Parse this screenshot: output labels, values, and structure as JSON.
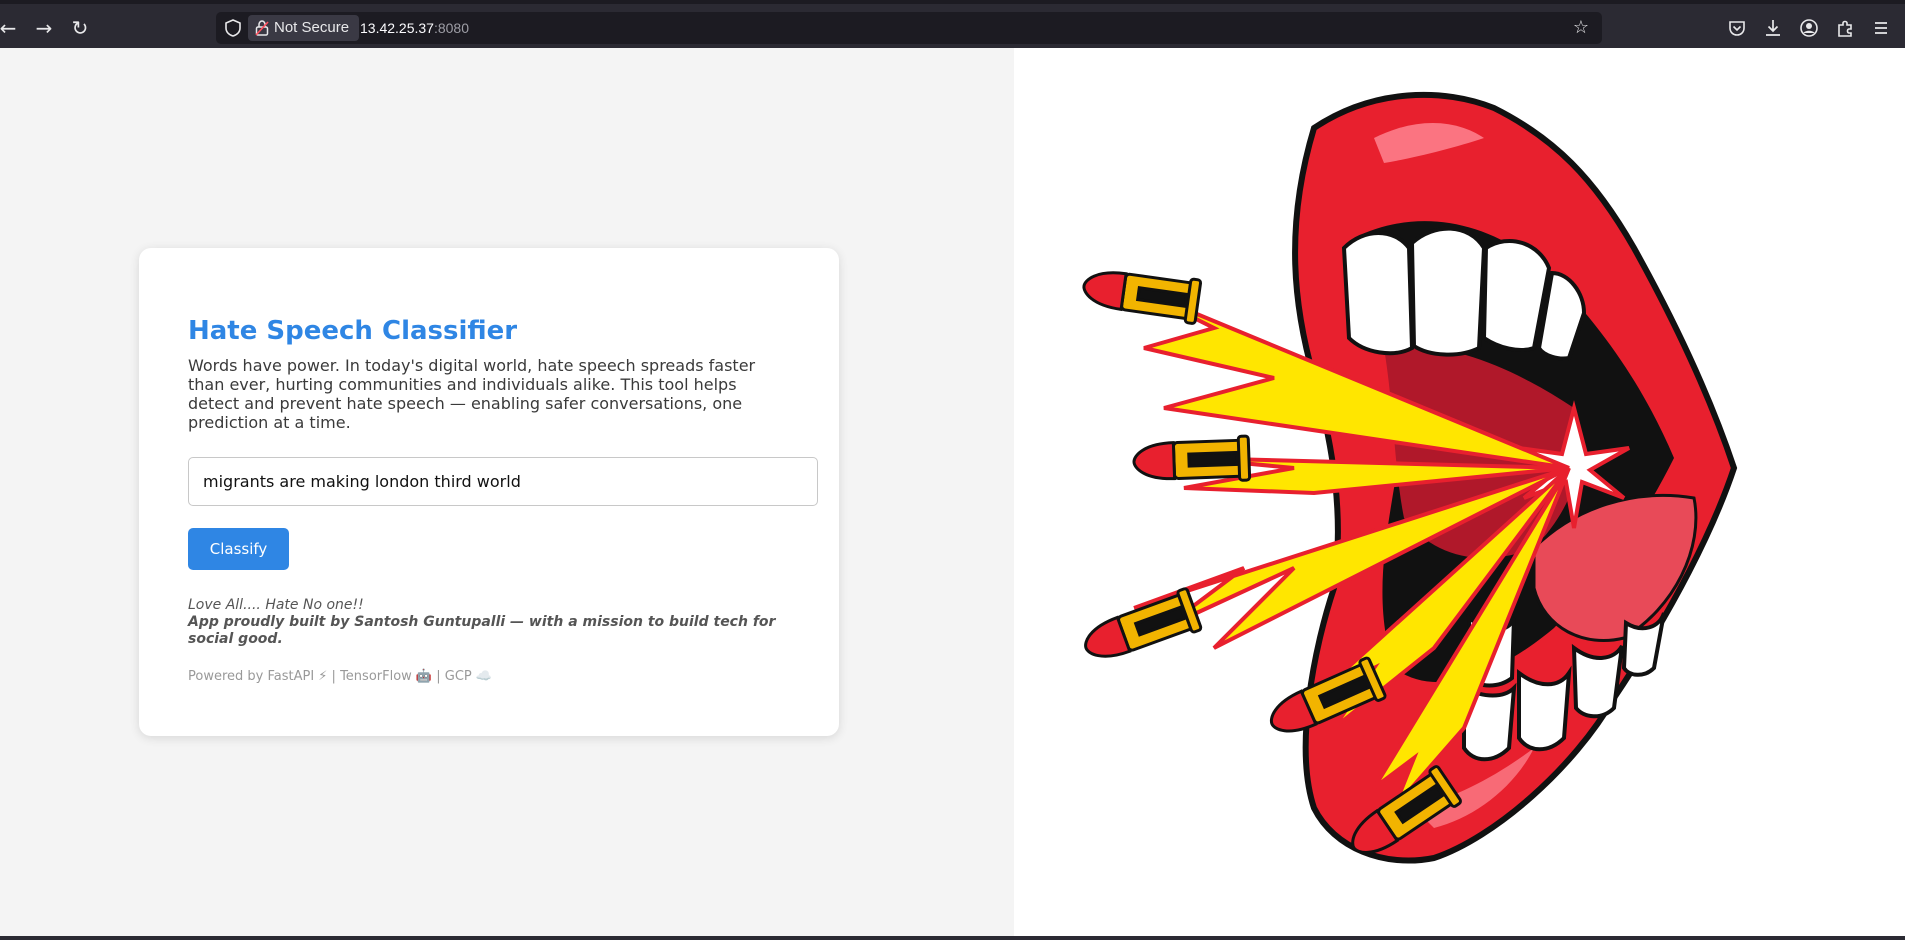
{
  "browser": {
    "security_label": "Not Secure",
    "url_host": "13.42.25.37",
    "url_port": ":8080",
    "icons": [
      "back-icon",
      "forward-icon",
      "reload-icon",
      "shield-icon",
      "lock-icon",
      "bookmark-star-icon",
      "pocket-icon",
      "download-icon",
      "account-icon",
      "extensions-icon",
      "menu-icon"
    ]
  },
  "card": {
    "title": "Hate Speech Classifier",
    "description": "Words have power. In today's digital world, hate speech spreads faster than ever, hurting communities and individuals alike. This tool helps detect and prevent hate speech — enabling safer conversations, one prediction at a time.",
    "input_value": "migrants are making london third world",
    "button_label": "Classify",
    "tagline": "Love All.... Hate No one!!",
    "credit": "App proudly built by Santosh Guntupalli — with a mission to build tech for social good.",
    "powered_by": "Powered by FastAPI ⚡ | TensorFlow 🤖 | GCP ☁️"
  },
  "colors": {
    "accent": "#2f86e4",
    "chrome_bg": "#2b2a33",
    "lips_red": "#e8202e",
    "flame_yellow": "#ffe600",
    "bullet_gold": "#f2b400"
  }
}
